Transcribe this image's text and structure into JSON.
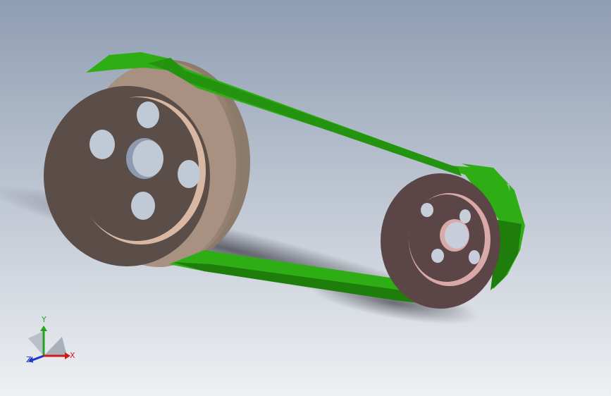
{
  "viewport": {
    "background_top": "#8f9db3",
    "background_bottom": "#eef0f2"
  },
  "model": {
    "belt_color": "#2eae14",
    "belt_dark": "#1f7d0c",
    "large_pulley_face": "#5b4d47",
    "large_pulley_inner": "#d8b7a3",
    "small_pulley_face": "#5c4546",
    "small_pulley_inner": "#d9a9a8",
    "shadow": "#3e3f47"
  },
  "triad": {
    "x_label": "X",
    "y_label": "Y",
    "z_label": "Z",
    "x_color": "#d11b1b",
    "y_color": "#23a524",
    "z_color": "#2136c9"
  }
}
